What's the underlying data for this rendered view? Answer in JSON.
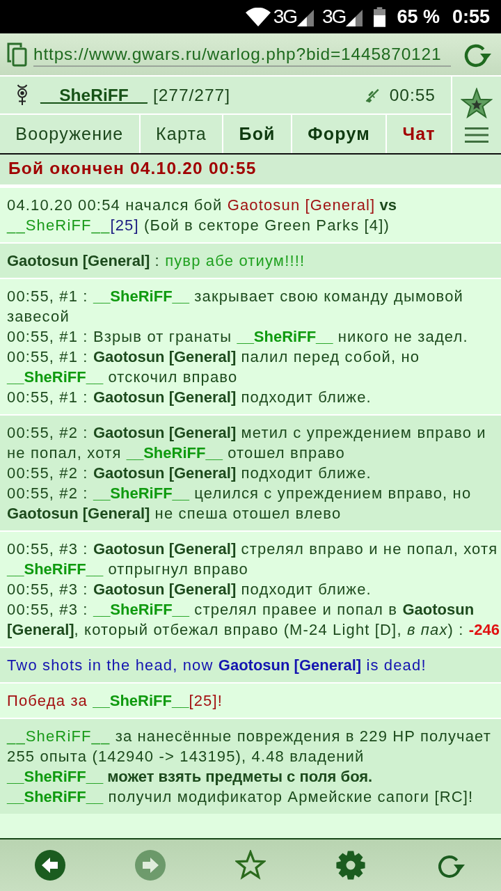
{
  "status_bar": {
    "networks": [
      "3G",
      "3G"
    ],
    "battery": "65 %",
    "time": "0:55"
  },
  "address_bar": {
    "url": "https://www.gwars.ru/warlog.php?bid=1445870121"
  },
  "header": {
    "player": "__SheRiFF__",
    "hp": "[277/277]",
    "time": "00:55",
    "tabs": [
      {
        "label": "Вооружение",
        "kind": "plain"
      },
      {
        "label": "Карта",
        "kind": "plain"
      },
      {
        "label": "Бой",
        "kind": "bold"
      },
      {
        "label": "Форум",
        "kind": "bold"
      },
      {
        "label": "Чат",
        "kind": "alert"
      }
    ]
  },
  "battle_title": "Бой окончен 04.10.20 00:55",
  "entries": [
    {
      "kind": "normal",
      "lines": [
        [
          {
            "kind": "text",
            "text": "04.10.20 00:54 начался бой "
          },
          {
            "kind": "foe",
            "text": "Gaotosun [General]"
          },
          {
            "kind": "bold",
            "text": " vs "
          },
          {
            "kind": "name",
            "text": "__SheRiFF__"
          },
          {
            "kind": "level",
            "text": "[25]"
          },
          {
            "kind": "text",
            "text": " (Бой в секторе Green Parks [4])"
          }
        ]
      ]
    },
    {
      "kind": "normal",
      "lines": [
        [
          {
            "kind": "bold",
            "text": "Gaotosun [General]"
          },
          {
            "kind": "text",
            "text": " : "
          },
          {
            "kind": "chat",
            "text": "пувр абе отиум!!!!"
          }
        ]
      ]
    },
    {
      "kind": "normal",
      "lines": [
        [
          {
            "kind": "text",
            "text": "00:55, #1 : "
          },
          {
            "kind": "ally",
            "text": "__SheRiFF__"
          },
          {
            "kind": "text",
            "text": " закрывает свою команду дымовой завесой"
          }
        ],
        [
          {
            "kind": "text",
            "text": "00:55, #1 : Взрыв от гранаты "
          },
          {
            "kind": "ally",
            "text": "__SheRiFF__"
          },
          {
            "kind": "text",
            "text": " никого не задел."
          }
        ],
        [
          {
            "kind": "text",
            "text": "00:55, #1 : "
          },
          {
            "kind": "bold",
            "text": "Gaotosun [General]"
          },
          {
            "kind": "text",
            "text": " палил перед собой, но "
          },
          {
            "kind": "ally",
            "text": "__SheRiFF__"
          },
          {
            "kind": "text",
            "text": " отскочил вправо"
          }
        ],
        [
          {
            "kind": "text",
            "text": "00:55, #1 : "
          },
          {
            "kind": "bold",
            "text": "Gaotosun [General]"
          },
          {
            "kind": "text",
            "text": " подходит ближе."
          }
        ]
      ]
    },
    {
      "kind": "normal",
      "lines": [
        [
          {
            "kind": "text",
            "text": "00:55, #2 : "
          },
          {
            "kind": "bold",
            "text": "Gaotosun [General]"
          },
          {
            "kind": "text",
            "text": " метил с упреждением вправо и не попал, хотя "
          },
          {
            "kind": "ally",
            "text": "__SheRiFF__"
          },
          {
            "kind": "text",
            "text": " отошел вправо"
          }
        ],
        [
          {
            "kind": "text",
            "text": "00:55, #2 : "
          },
          {
            "kind": "bold",
            "text": "Gaotosun [General]"
          },
          {
            "kind": "text",
            "text": " подходит ближе."
          }
        ],
        [
          {
            "kind": "text",
            "text": "00:55, #2 : "
          },
          {
            "kind": "ally",
            "text": "__SheRiFF__"
          },
          {
            "kind": "text",
            "text": " целился с упреждением вправо, но "
          },
          {
            "kind": "bold",
            "text": "Gaotosun [General]"
          },
          {
            "kind": "text",
            "text": " не спеша отошел влево"
          }
        ]
      ]
    },
    {
      "kind": "normal",
      "lines": [
        [
          {
            "kind": "text",
            "text": "00:55, #3 : "
          },
          {
            "kind": "bold",
            "text": "Gaotosun [General]"
          },
          {
            "kind": "text",
            "text": " стрелял вправо и не попал, хотя "
          },
          {
            "kind": "ally",
            "text": "__SheRiFF__"
          },
          {
            "kind": "text",
            "text": " отпрыгнул вправо"
          }
        ],
        [
          {
            "kind": "text",
            "text": "00:55, #3 : "
          },
          {
            "kind": "bold",
            "text": "Gaotosun [General]"
          },
          {
            "kind": "text",
            "text": " подходит ближе."
          }
        ],
        [
          {
            "kind": "text",
            "text": "00:55, #3 : "
          },
          {
            "kind": "ally",
            "text": "__SheRiFF__"
          },
          {
            "kind": "text",
            "text": " стрелял правее и попал в "
          },
          {
            "kind": "bold",
            "text": "Gaotosun [General]"
          },
          {
            "kind": "text",
            "text": ", который отбежал вправо (M-24 Light [D], "
          },
          {
            "kind": "italic",
            "text": "в пах"
          },
          {
            "kind": "text",
            "text": ") : "
          },
          {
            "kind": "damage",
            "text": "-246"
          }
        ]
      ]
    },
    {
      "kind": "announce",
      "lines": [
        [
          {
            "kind": "text",
            "text": "Two shots in the head, now "
          },
          {
            "kind": "bold",
            "text": "Gaotosun [General]"
          },
          {
            "kind": "text",
            "text": " is dead!"
          }
        ]
      ]
    },
    {
      "kind": "victory",
      "lines": [
        [
          {
            "kind": "text",
            "text": "Победа за "
          },
          {
            "kind": "ally",
            "text": "__SheRiFF__"
          },
          {
            "kind": "text",
            "text": "[25]!"
          }
        ]
      ]
    },
    {
      "kind": "normal",
      "lines": [
        [
          {
            "kind": "name",
            "text": "__SheRiFF__"
          },
          {
            "kind": "text",
            "text": " за нанесённые повреждения в 229 HP получает 255 опыта (142940 -> 143195), 4.48 владений"
          }
        ],
        [
          {
            "kind": "ally",
            "text": "__SheRiFF__"
          },
          {
            "kind": "bold",
            "text": " может взять предметы с поля боя."
          }
        ],
        [
          {
            "kind": "ally",
            "text": "__SheRiFF__"
          },
          {
            "kind": "text",
            "text": " получил модификатор Армейские сапоги [RC]!"
          }
        ]
      ]
    }
  ],
  "bottom_bar": [
    {
      "kind": "back",
      "disabled": false
    },
    {
      "kind": "forward",
      "disabled": true
    },
    {
      "kind": "bookmark",
      "disabled": false
    },
    {
      "kind": "settings",
      "disabled": false
    },
    {
      "kind": "reload",
      "disabled": false
    }
  ]
}
